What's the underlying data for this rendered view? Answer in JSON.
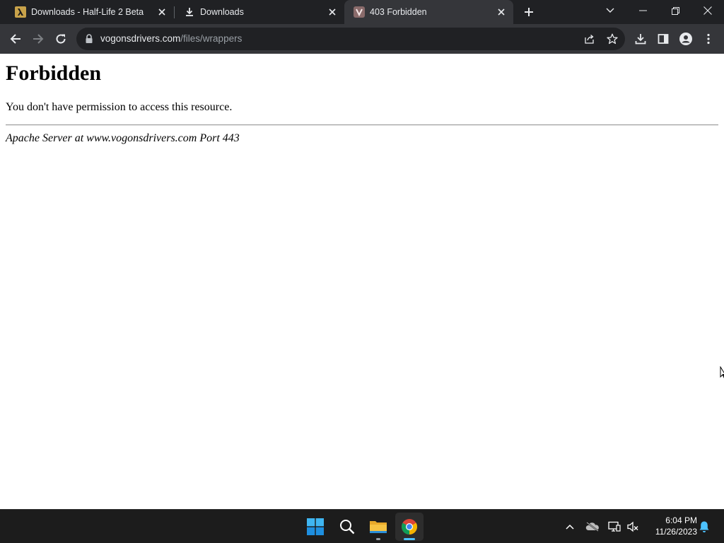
{
  "browser": {
    "tabs": [
      {
        "title": "Downloads - Half-Life 2 Beta",
        "favicon": "half-life-lambda-icon",
        "active": false
      },
      {
        "title": "Downloads",
        "favicon": "download-arrow-icon",
        "active": false
      },
      {
        "title": "403 Forbidden",
        "favicon": "vogons-icon",
        "active": true
      }
    ],
    "address_bar": {
      "host": "vogonsdrivers.com",
      "path": "/files/wrappers"
    }
  },
  "page": {
    "heading": "Forbidden",
    "message": "You don't have permission to access this resource.",
    "server_signature": "Apache Server at www.vogonsdrivers.com Port 443"
  },
  "taskbar": {
    "time": "6:04 PM",
    "date": "11/26/2023",
    "pinned": [
      "start-icon",
      "search-icon",
      "file-explorer-icon",
      "chrome-icon"
    ]
  },
  "colors": {
    "tabstrip_bg": "#202124",
    "toolbar_bg": "#35363a",
    "omnibox_bg": "#202124",
    "taskbar_bg": "#1c1c1c",
    "accent_blue": "#4cc2ff"
  }
}
